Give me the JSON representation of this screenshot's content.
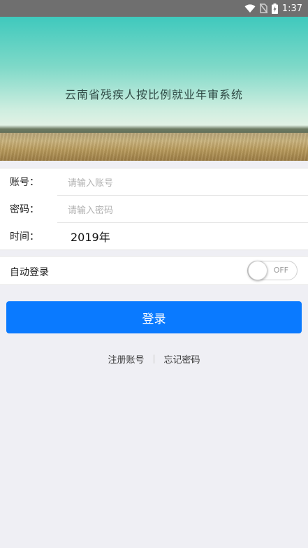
{
  "status_bar": {
    "time": "1:37",
    "icons": [
      "wifi-icon",
      "no-sim-icon",
      "battery-charging-icon"
    ]
  },
  "banner": {
    "title": "云南省残疾人按比例就业年审系统"
  },
  "form": {
    "account": {
      "label": "账号：",
      "placeholder": "请输入账号"
    },
    "password": {
      "label": "密码：",
      "placeholder": "请输入密码"
    },
    "time": {
      "label": "时间：",
      "value": "2019年"
    }
  },
  "auto_login": {
    "label": "自动登录",
    "toggle_text": "OFF",
    "enabled": false
  },
  "login_button": {
    "label": "登录"
  },
  "links": {
    "register": "注册账号",
    "divider": "|",
    "forgot": "忘记密码"
  },
  "colors": {
    "primary": "#0a7aff",
    "background": "#efeff4",
    "status_bar": "#6f6f6f"
  }
}
